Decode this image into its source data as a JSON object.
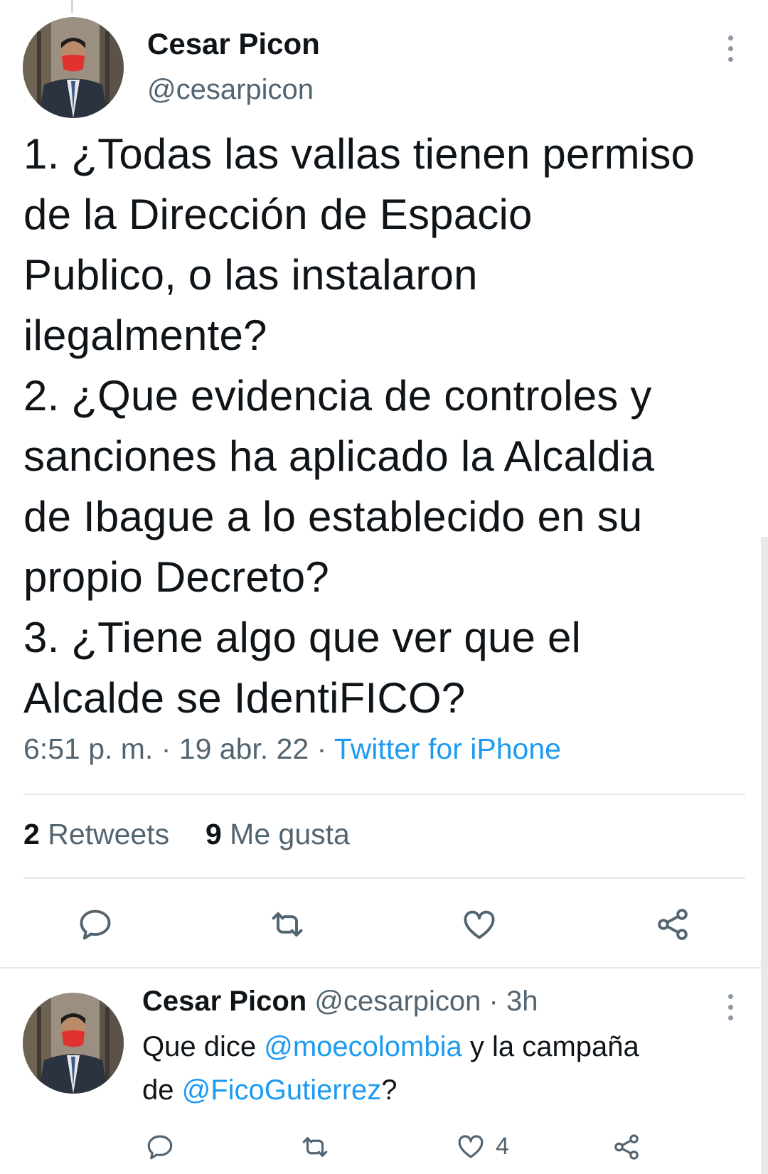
{
  "main_tweet": {
    "author_name": "Cesar Picon",
    "author_handle": "@cesarpicon",
    "text_lines": [
      "1. ¿Todas las vallas tienen permiso",
      "de la Dirección de Espacio",
      "Publico, o las instalaron",
      "ilegalmente?",
      "2. ¿Que evidencia de controles y",
      "sanciones ha aplicado la Alcaldia",
      "de Ibague a lo establecido en su",
      "propio Decreto?",
      "3. ¿Tiene algo que ver que el",
      "Alcalde se IdentiFICO?"
    ],
    "time": "6:51 p. m.",
    "date": "19 abr. 22",
    "separator": "·",
    "source": "Twitter for iPhone",
    "retweets_count": "2",
    "retweets_label": "Retweets",
    "likes_count": "9",
    "likes_label": "Me gusta",
    "icons": [
      "reply-icon",
      "retweet-icon",
      "like-icon",
      "share-icon"
    ]
  },
  "reply_tweet": {
    "author_name": "Cesar Picon",
    "author_handle": "@cesarpicon",
    "separator": "·",
    "time_ago": "3h",
    "text_part1": "Que dice ",
    "mention1": "@moecolombia",
    "text_part2": " y la campaña",
    "text_part3": "de ",
    "mention2": "@FicoGutierrez",
    "text_part4": "?",
    "like_count": "4",
    "icons": [
      "reply-icon",
      "retweet-icon",
      "like-icon",
      "share-icon"
    ]
  },
  "colors": {
    "link": "#1d9bf0",
    "muted": "#536471",
    "text": "#0f1419",
    "mask": "#e0322e"
  }
}
